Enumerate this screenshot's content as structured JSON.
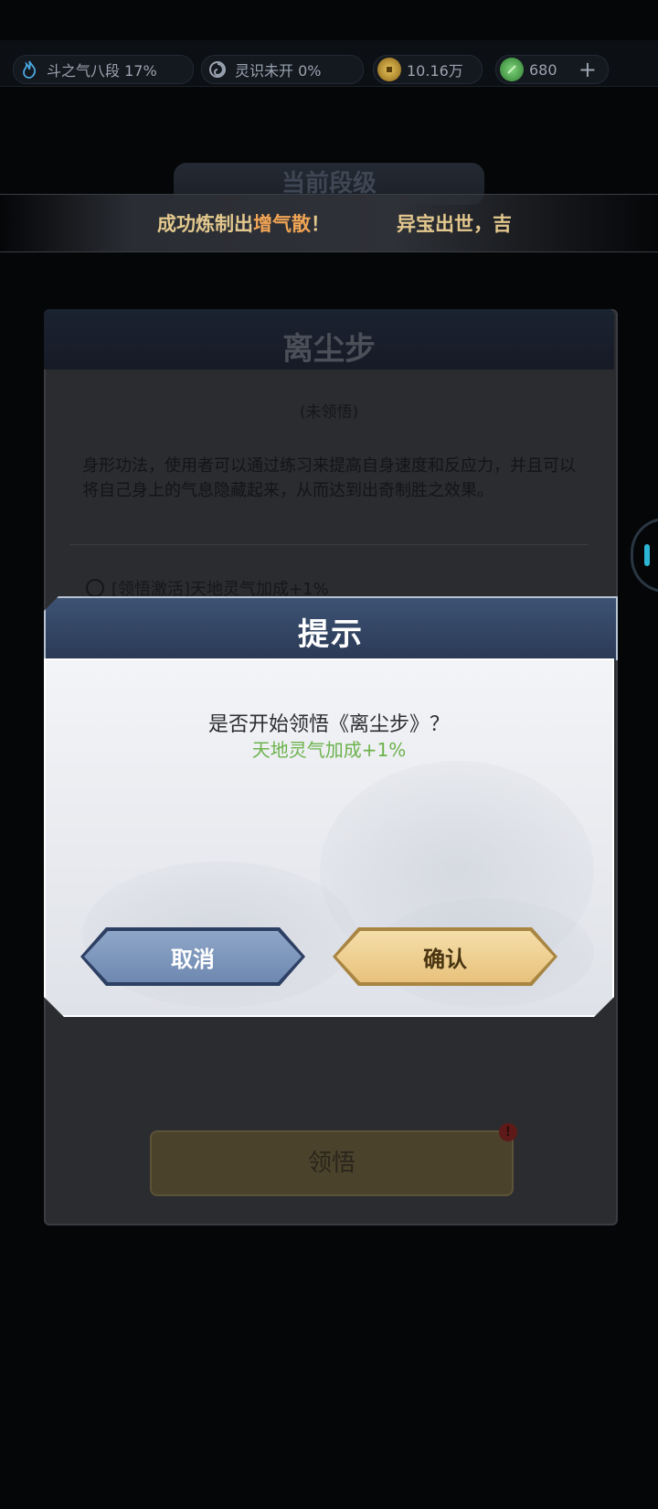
{
  "topbar": {
    "cultivation": {
      "label": "斗之气八段 17%",
      "icon": "flame-icon",
      "color": "#4aa8e0"
    },
    "spirit": {
      "label": "灵识未开 0%",
      "icon": "swirl-icon",
      "color": "#9aa4b0"
    },
    "gold": {
      "label": "10.16万",
      "icon": "coin-icon",
      "color": "#d9a83a"
    },
    "jade": {
      "label": "680",
      "icon": "jade-icon",
      "color": "#4fae52",
      "add": "+"
    }
  },
  "background": {
    "rank_tab": "当前段级",
    "marquee": {
      "prefix": "成功炼制出",
      "highlight": "增气散",
      "suffix": "！",
      "next": "异宝出世，吉"
    },
    "skill_title": "离尘步",
    "status": "(未领悟)",
    "description": "身形功法，使用者可以通过练习来提高自身速度和反应力，并且可以将自己身上的气息隐藏起来，从而达到出奇制胜之效果。",
    "bonus": "[领悟激活]天地灵气加成+1%",
    "comprehend_button": "领悟",
    "badge": "!"
  },
  "dialog": {
    "title": "提示",
    "question": "是否开始领悟《离尘步》？",
    "bonus": "天地灵气加成+1%",
    "cancel": "取消",
    "confirm": "确认"
  }
}
